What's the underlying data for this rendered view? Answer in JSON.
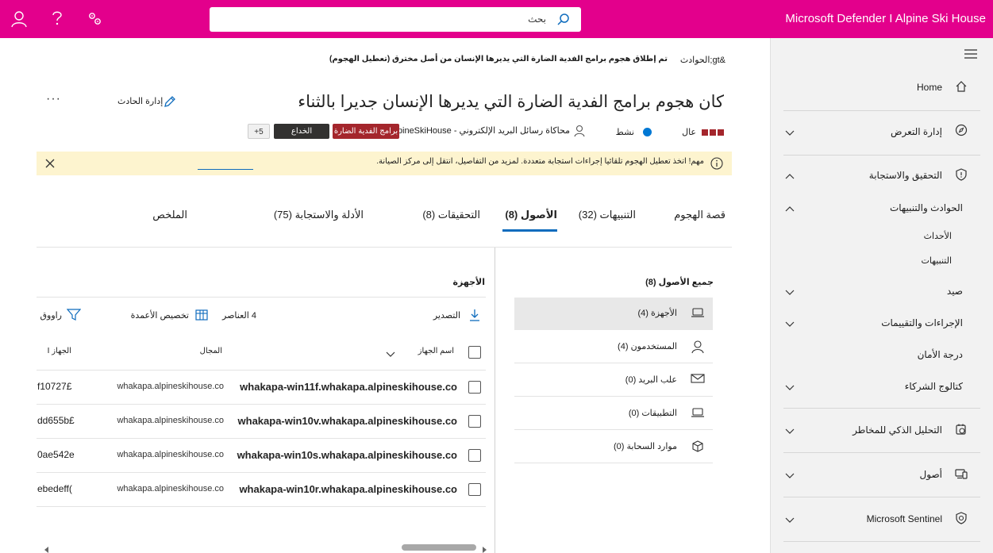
{
  "app": {
    "title": "Microsoft Defender I Alpine Ski House"
  },
  "search": {
    "value": "بحث",
    "placeholder": ""
  },
  "sidebar": {
    "items": [
      {
        "label": "Home"
      },
      {
        "label": "إدارة التعرض"
      },
      {
        "label": "التحقيق والاستجابة"
      },
      {
        "label": "الحوادث والتنبيهات"
      },
      {
        "label": "الأحداث"
      },
      {
        "label": "التنبيهات"
      },
      {
        "label": "صيد"
      },
      {
        "label": "الإجراءات والتقييمات"
      },
      {
        "label": "درجة الأمان"
      },
      {
        "label": "كتالوج الشركاء"
      },
      {
        "label": "التحليل الذكي للمخاطر"
      },
      {
        "label": "أصول"
      },
      {
        "label": "Microsoft Sentinel"
      }
    ]
  },
  "breadcrumb": {
    "root": "&gt;الحوادث",
    "current": "تم إطلاق هجوم برامج الفدية الضارة التي يديرها الإنسان من أصل مخترق (تعطيل الهجوم)"
  },
  "incident": {
    "title": "كان هجوم برامج الفدية الضارة التي يديرها الإنسان جديرا بالثناء",
    "manage_label": "إدارة الحادث",
    "more_label": "···",
    "severity": "عال",
    "status": "نشط",
    "assigned": "محاكاة رسائل البريد الإلكتروني - AlpineSkiHouse",
    "tags": [
      "برامج الفدية الضارة",
      "الخداع",
      "+5"
    ]
  },
  "banner": {
    "text": "مهم! اتخذ تعطيل الهجوم تلقائيا إجراءات استجابة متعددة. لمزيد من التفاصيل، انتقل إلى مركز الصيانة."
  },
  "tabs": [
    {
      "label": "قصة الهجوم"
    },
    {
      "label": "التنبيهات (32)"
    },
    {
      "label": "الأصول (8)"
    },
    {
      "label": "التحقيقات (8)"
    },
    {
      "label": "الأدلة والاستجابة (75)"
    },
    {
      "label": "الملخص"
    }
  ],
  "assets": {
    "header": "جميع الأصول (8)",
    "items": [
      {
        "label": "الأجهزة (4)"
      },
      {
        "label": "المستخدمون (4)"
      },
      {
        "label": "علب البريد (0)"
      },
      {
        "label": "التطبيقات (0)"
      },
      {
        "label": "موارد السحابة (0)"
      }
    ]
  },
  "devices": {
    "section_title": "الأجهزة",
    "toolbar": {
      "export": "التصدير",
      "items": "4 العناصر",
      "columns": "تخصيص الأعمدة",
      "filter": "راووق"
    },
    "columns": [
      "اسم الجهاز",
      "المجال",
      "الجهاز I"
    ],
    "rows": [
      {
        "name": "whakapa-win11f.whakapa.alpineskihouse.co",
        "domain": "whakapa.alpineskihouse.co",
        "id": "f10727£"
      },
      {
        "name": "whakapa-win10v.whakapa.alpineskihouse.co",
        "domain": "whakapa.alpineskihouse.co",
        "id": "dd655b£"
      },
      {
        "name": "whakapa-win10s.whakapa.alpineskihouse.co",
        "domain": "whakapa.alpineskihouse.co",
        "id": "0ae542e"
      },
      {
        "name": "whakapa-win10r.whakapa.alpineskihouse.co",
        "domain": "whakapa.alpineskihouse.co",
        "id": "ebedeff("
      }
    ]
  },
  "colors": {
    "topbar": "#e3008c",
    "severity": "#a4262c",
    "status": "#0078d4",
    "accent": "#0f6cbd",
    "banner": "#fdf4cf"
  },
  "icons": {
    "topbar": [
      "person-icon",
      "help-icon",
      "settings-icon",
      "search-icon"
    ],
    "sidebar": [
      "hamburger-icon",
      "home-icon",
      "compass-icon",
      "shield-icon",
      "chevron-icon"
    ]
  }
}
